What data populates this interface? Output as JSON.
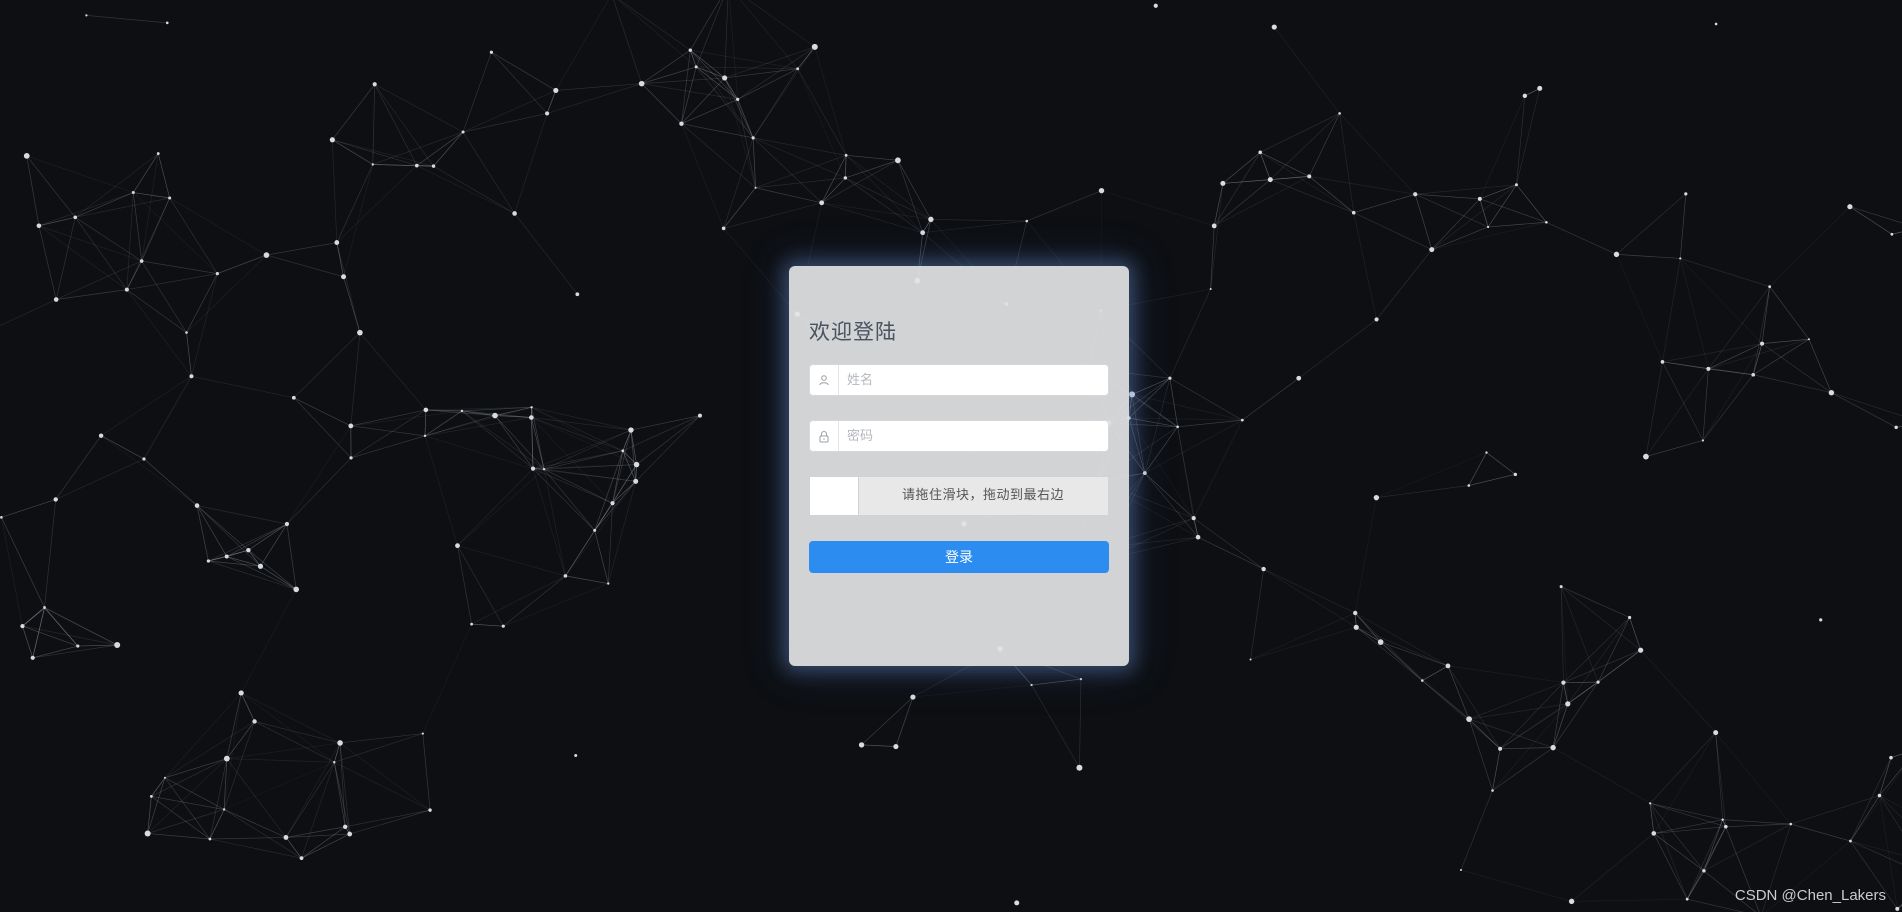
{
  "login": {
    "title": "欢迎登陆",
    "name_placeholder": "姓名",
    "password_placeholder": "密码",
    "slider_hint": "请拖住滑块，拖动到最右边",
    "submit_label": "登录",
    "name_icon": "user-icon",
    "password_icon": "lock-icon",
    "accent_color": "#2d8cf0"
  },
  "watermark": "CSDN @Chen_Lakers",
  "background": {
    "color": "#0d0f12",
    "effect": "particle-network"
  }
}
